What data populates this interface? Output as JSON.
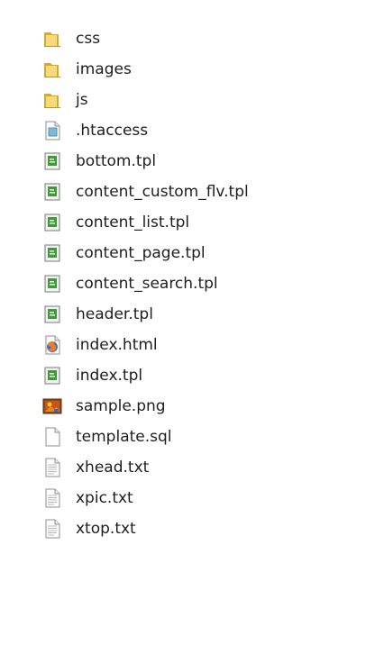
{
  "items": [
    {
      "name": "css",
      "icon": "folder-icon"
    },
    {
      "name": "images",
      "icon": "folder-icon"
    },
    {
      "name": "js",
      "icon": "folder-icon"
    },
    {
      "name": ".htaccess",
      "icon": "config-file-icon"
    },
    {
      "name": "bottom.tpl",
      "icon": "template-file-icon"
    },
    {
      "name": "content_custom_flv.tpl",
      "icon": "template-file-icon"
    },
    {
      "name": "content_list.tpl",
      "icon": "template-file-icon"
    },
    {
      "name": "content_page.tpl",
      "icon": "template-file-icon"
    },
    {
      "name": "content_search.tpl",
      "icon": "template-file-icon"
    },
    {
      "name": "header.tpl",
      "icon": "template-file-icon"
    },
    {
      "name": "index.html",
      "icon": "firefox-html-icon"
    },
    {
      "name": "index.tpl",
      "icon": "template-file-icon"
    },
    {
      "name": "sample.png",
      "icon": "image-file-icon"
    },
    {
      "name": "template.sql",
      "icon": "blank-file-icon"
    },
    {
      "name": "xhead.txt",
      "icon": "text-file-icon"
    },
    {
      "name": "xpic.txt",
      "icon": "text-file-icon"
    },
    {
      "name": "xtop.txt",
      "icon": "text-file-icon"
    }
  ],
  "colors": {
    "folder_light": "#f5d97a",
    "folder_dark": "#d9a92a",
    "template_green": "#3f9a3a",
    "text": "#1e1e1e"
  }
}
